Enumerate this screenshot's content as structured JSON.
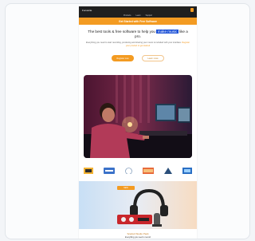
{
  "brand": {
    "name": "Focusrite"
  },
  "nav": {
    "items": [
      "Products",
      "Learn",
      "Support"
    ]
  },
  "banner": {
    "text": "Get Started with Free Software"
  },
  "hero": {
    "headline_before": "The best tools & free software to help you",
    "headline_highlight": "make music",
    "headline_after": "like a pro.",
    "body": "Everything you need to start recording, producing and sharing your music is included with your interface.",
    "accent_text": "Register your product to get started",
    "primary_cta": "Register now",
    "secondary_cta": "Learn more"
  },
  "logos": [
    "ableton-logo",
    "plugin-logo",
    "circle-logo",
    "brand-logo",
    "triangle-logo",
    "blue-logo"
  ],
  "promo": {
    "tag": "NEW",
    "title": "Scarlett Studio Pack",
    "subtitle": "Everything you need to record"
  },
  "colors": {
    "accent": "#f39b22",
    "highlight": "#1a4fd6",
    "dark": "#1f1f1f"
  }
}
